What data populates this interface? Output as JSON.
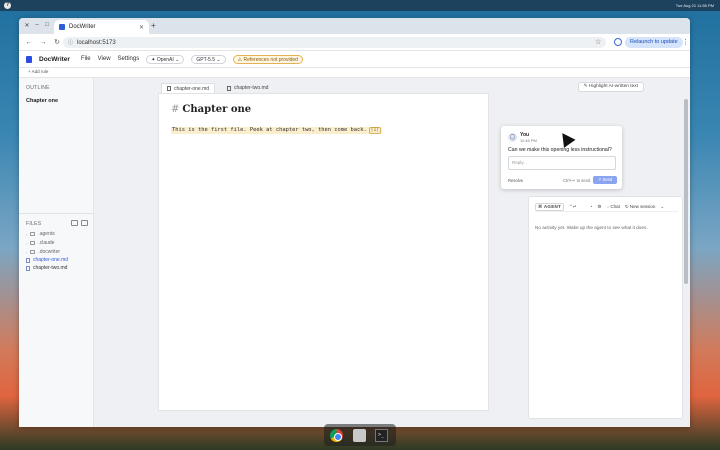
{
  "os": {
    "clock": "Tue Aug 21  11:55 PM"
  },
  "browser": {
    "tab_title": "DocWriter",
    "url": "localhost:5173",
    "relaunch_label": "Relaunch to update"
  },
  "app": {
    "name": "DocWriter",
    "menus": [
      "File",
      "View",
      "Settings"
    ],
    "provider": "OpenAI",
    "model": "GPT-5.5",
    "warning": "References not provided",
    "add_rule": "+ Add rule"
  },
  "sidebar": {
    "outline_heading": "OUTLINE",
    "outline_item": "Chapter one",
    "files_heading": "FILES",
    "files": [
      {
        "name": ".agents",
        "kind": "folder"
      },
      {
        "name": ".claude",
        "kind": "folder"
      },
      {
        "name": ".docwriter",
        "kind": "folder"
      },
      {
        "name": "chapter-one.md",
        "kind": "file",
        "active": true
      },
      {
        "name": "chapter-two.md",
        "kind": "file"
      }
    ]
  },
  "editor": {
    "tabs": [
      "chapter-one.md",
      "chapter-two.md"
    ],
    "highlight_label": "Highlight AI-written text",
    "heading": "Chapter one",
    "line": "This is the first file. Peek at chapter two, then come back.",
    "badge": "[1]"
  },
  "comment": {
    "author": "You",
    "time": "11:46 PM",
    "text": "Can we make this opening less instructional?",
    "reply_placeholder": "Reply...",
    "resolve": "Resolve",
    "hint": "Ctrl+↵ to send",
    "send": "Send"
  },
  "agent": {
    "tag": "AGENT",
    "chat": "Chat",
    "new_session": "New session",
    "empty": "No activity yet. Wake up the agent to see what it does."
  },
  "dock": {
    "term_glyph": ">_"
  }
}
